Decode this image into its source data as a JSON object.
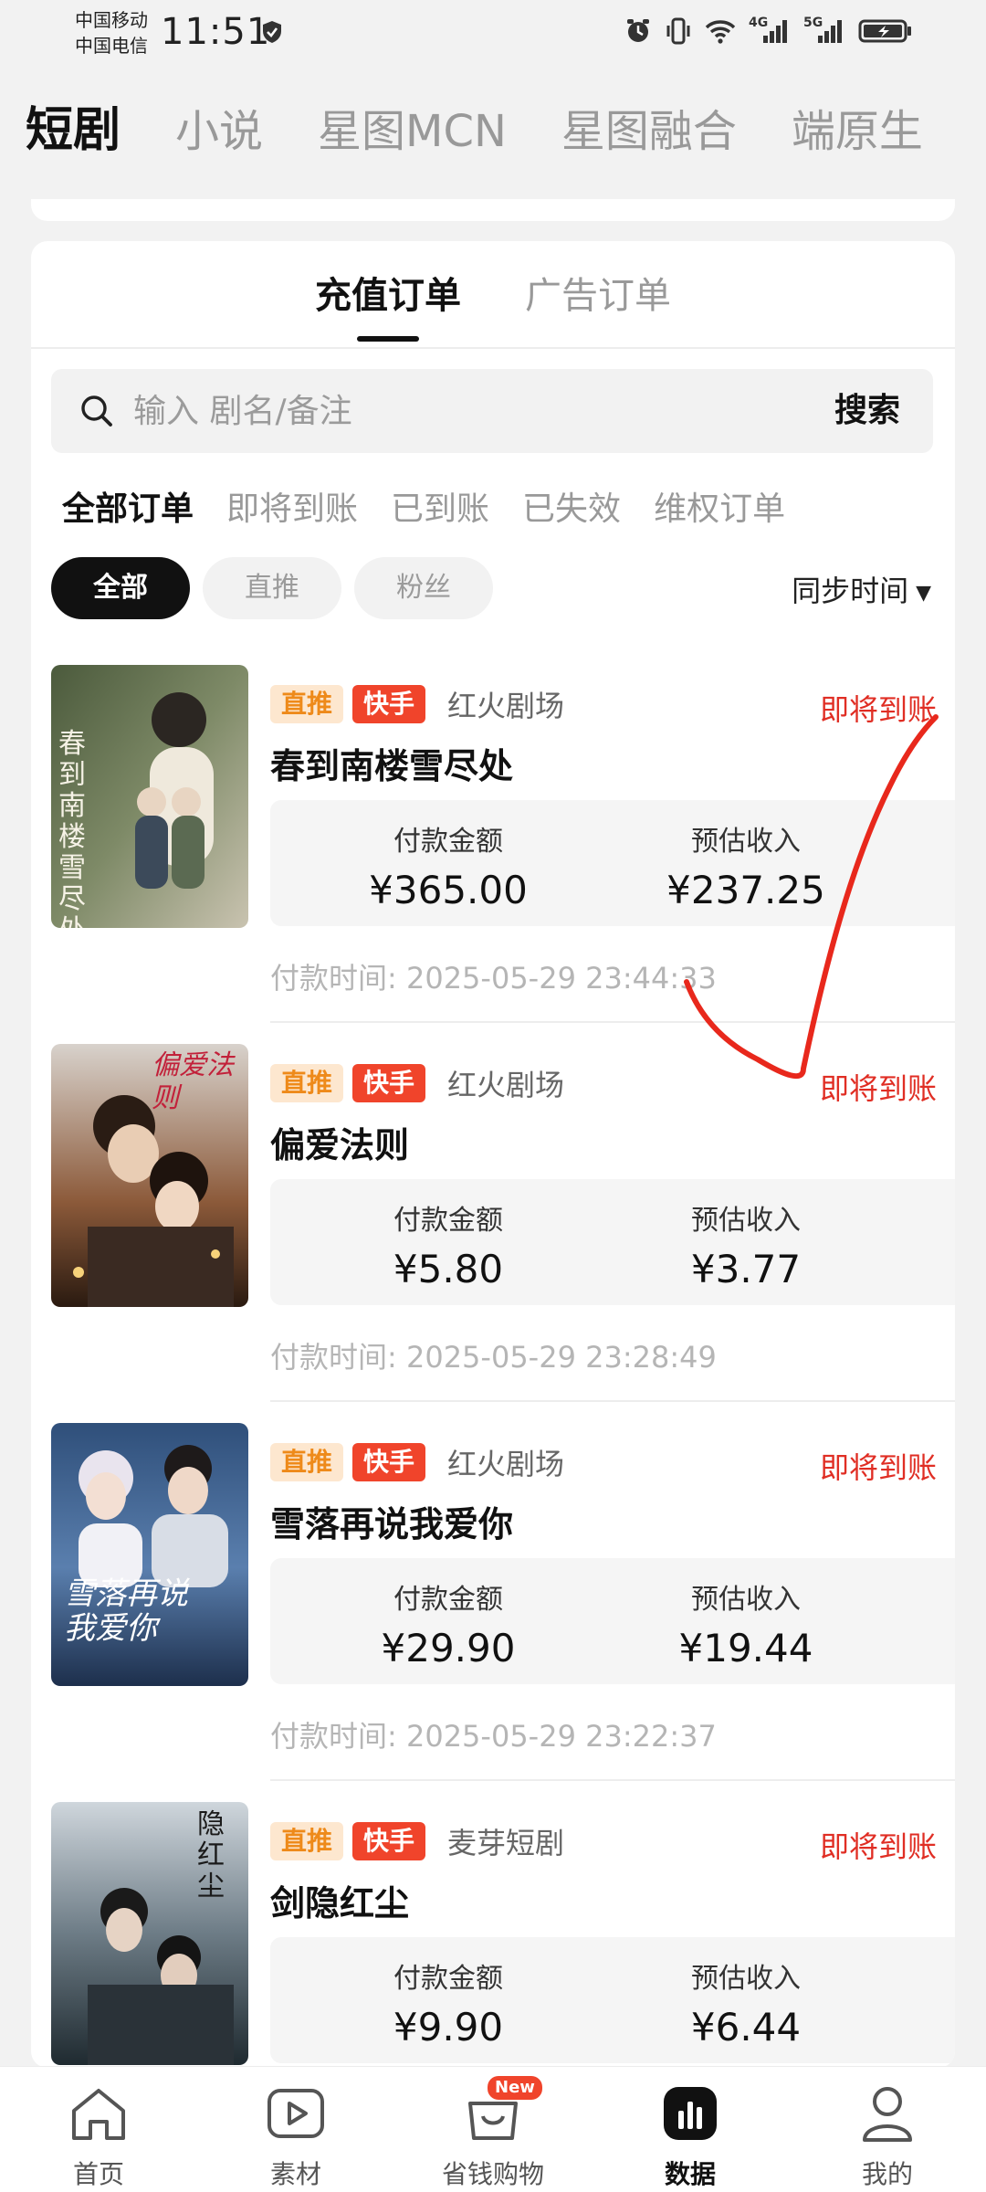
{
  "status_bar": {
    "carrier_1": "中国移动",
    "carrier_2": "中国电信",
    "time": "11:51",
    "network_1": "4G",
    "network_2": "5G"
  },
  "top_tabs": [
    "短剧",
    "小说",
    "星图MCN",
    "星图融合",
    "端原生"
  ],
  "order_tabs": [
    "充值订单",
    "广告订单"
  ],
  "search": {
    "placeholder": "输入 剧名/备注",
    "button": "搜索"
  },
  "filters": [
    "全部订单",
    "即将到账",
    "已到账",
    "已失效",
    "维权订单"
  ],
  "chips": [
    "全部",
    "直推",
    "粉丝"
  ],
  "sync_label": "同步时间",
  "labels": {
    "pay_amount": "付款金额",
    "est_income": "预估收入",
    "pay_time_prefix": "付款时间:"
  },
  "orders": [
    {
      "tag_push": "直推",
      "tag_platform": "快手",
      "studio": "红火剧场",
      "status": "即将到账",
      "title": "春到南楼雪尽处",
      "pay_amount": "¥365.00",
      "est_income": "¥237.25",
      "pay_time": "2025-05-29 23:44:33",
      "poster_text": "春到南楼雪尽处"
    },
    {
      "tag_push": "直推",
      "tag_platform": "快手",
      "studio": "红火剧场",
      "status": "即将到账",
      "title": "偏爱法则",
      "pay_amount": "¥5.80",
      "est_income": "¥3.77",
      "pay_time": "2025-05-29 23:28:49",
      "poster_text": "偏爱法则"
    },
    {
      "tag_push": "直推",
      "tag_platform": "快手",
      "studio": "红火剧场",
      "status": "即将到账",
      "title": "雪落再说我爱你",
      "pay_amount": "¥29.90",
      "est_income": "¥19.44",
      "pay_time": "2025-05-29 23:22:37",
      "poster_text": "雪落再说我爱你"
    },
    {
      "tag_push": "直推",
      "tag_platform": "快手",
      "studio": "麦芽短剧",
      "status": "即将到账",
      "title": "剑隐红尘",
      "pay_amount": "¥9.90",
      "est_income": "¥6.44",
      "pay_time": "",
      "poster_text": "隐红尘"
    }
  ],
  "bottom_nav": [
    {
      "label": "首页",
      "icon": "home-icon"
    },
    {
      "label": "素材",
      "icon": "play-icon"
    },
    {
      "label": "省钱购物",
      "icon": "shopping-bag-icon",
      "badge": "New"
    },
    {
      "label": "数据",
      "icon": "chart-icon"
    },
    {
      "label": "我的",
      "icon": "user-icon"
    }
  ],
  "colors": {
    "accent_red": "#e02e24",
    "badge_orange_bg": "#fde7cf",
    "badge_orange_text": "#ee8a1a",
    "kuaishou_red": "#f0442b"
  }
}
